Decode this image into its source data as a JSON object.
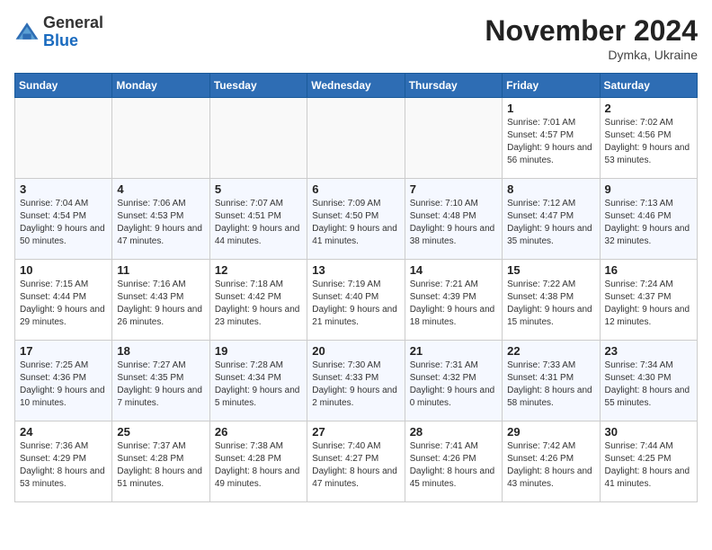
{
  "header": {
    "logo": {
      "line1": "General",
      "line2": "Blue"
    },
    "title": "November 2024",
    "subtitle": "Dymka, Ukraine"
  },
  "weekdays": [
    "Sunday",
    "Monday",
    "Tuesday",
    "Wednesday",
    "Thursday",
    "Friday",
    "Saturday"
  ],
  "weeks": [
    [
      {
        "day": "",
        "detail": ""
      },
      {
        "day": "",
        "detail": ""
      },
      {
        "day": "",
        "detail": ""
      },
      {
        "day": "",
        "detail": ""
      },
      {
        "day": "",
        "detail": ""
      },
      {
        "day": "1",
        "detail": "Sunrise: 7:01 AM\nSunset: 4:57 PM\nDaylight: 9 hours and 56 minutes."
      },
      {
        "day": "2",
        "detail": "Sunrise: 7:02 AM\nSunset: 4:56 PM\nDaylight: 9 hours and 53 minutes."
      }
    ],
    [
      {
        "day": "3",
        "detail": "Sunrise: 7:04 AM\nSunset: 4:54 PM\nDaylight: 9 hours and 50 minutes."
      },
      {
        "day": "4",
        "detail": "Sunrise: 7:06 AM\nSunset: 4:53 PM\nDaylight: 9 hours and 47 minutes."
      },
      {
        "day": "5",
        "detail": "Sunrise: 7:07 AM\nSunset: 4:51 PM\nDaylight: 9 hours and 44 minutes."
      },
      {
        "day": "6",
        "detail": "Sunrise: 7:09 AM\nSunset: 4:50 PM\nDaylight: 9 hours and 41 minutes."
      },
      {
        "day": "7",
        "detail": "Sunrise: 7:10 AM\nSunset: 4:48 PM\nDaylight: 9 hours and 38 minutes."
      },
      {
        "day": "8",
        "detail": "Sunrise: 7:12 AM\nSunset: 4:47 PM\nDaylight: 9 hours and 35 minutes."
      },
      {
        "day": "9",
        "detail": "Sunrise: 7:13 AM\nSunset: 4:46 PM\nDaylight: 9 hours and 32 minutes."
      }
    ],
    [
      {
        "day": "10",
        "detail": "Sunrise: 7:15 AM\nSunset: 4:44 PM\nDaylight: 9 hours and 29 minutes."
      },
      {
        "day": "11",
        "detail": "Sunrise: 7:16 AM\nSunset: 4:43 PM\nDaylight: 9 hours and 26 minutes."
      },
      {
        "day": "12",
        "detail": "Sunrise: 7:18 AM\nSunset: 4:42 PM\nDaylight: 9 hours and 23 minutes."
      },
      {
        "day": "13",
        "detail": "Sunrise: 7:19 AM\nSunset: 4:40 PM\nDaylight: 9 hours and 21 minutes."
      },
      {
        "day": "14",
        "detail": "Sunrise: 7:21 AM\nSunset: 4:39 PM\nDaylight: 9 hours and 18 minutes."
      },
      {
        "day": "15",
        "detail": "Sunrise: 7:22 AM\nSunset: 4:38 PM\nDaylight: 9 hours and 15 minutes."
      },
      {
        "day": "16",
        "detail": "Sunrise: 7:24 AM\nSunset: 4:37 PM\nDaylight: 9 hours and 12 minutes."
      }
    ],
    [
      {
        "day": "17",
        "detail": "Sunrise: 7:25 AM\nSunset: 4:36 PM\nDaylight: 9 hours and 10 minutes."
      },
      {
        "day": "18",
        "detail": "Sunrise: 7:27 AM\nSunset: 4:35 PM\nDaylight: 9 hours and 7 minutes."
      },
      {
        "day": "19",
        "detail": "Sunrise: 7:28 AM\nSunset: 4:34 PM\nDaylight: 9 hours and 5 minutes."
      },
      {
        "day": "20",
        "detail": "Sunrise: 7:30 AM\nSunset: 4:33 PM\nDaylight: 9 hours and 2 minutes."
      },
      {
        "day": "21",
        "detail": "Sunrise: 7:31 AM\nSunset: 4:32 PM\nDaylight: 9 hours and 0 minutes."
      },
      {
        "day": "22",
        "detail": "Sunrise: 7:33 AM\nSunset: 4:31 PM\nDaylight: 8 hours and 58 minutes."
      },
      {
        "day": "23",
        "detail": "Sunrise: 7:34 AM\nSunset: 4:30 PM\nDaylight: 8 hours and 55 minutes."
      }
    ],
    [
      {
        "day": "24",
        "detail": "Sunrise: 7:36 AM\nSunset: 4:29 PM\nDaylight: 8 hours and 53 minutes."
      },
      {
        "day": "25",
        "detail": "Sunrise: 7:37 AM\nSunset: 4:28 PM\nDaylight: 8 hours and 51 minutes."
      },
      {
        "day": "26",
        "detail": "Sunrise: 7:38 AM\nSunset: 4:28 PM\nDaylight: 8 hours and 49 minutes."
      },
      {
        "day": "27",
        "detail": "Sunrise: 7:40 AM\nSunset: 4:27 PM\nDaylight: 8 hours and 47 minutes."
      },
      {
        "day": "28",
        "detail": "Sunrise: 7:41 AM\nSunset: 4:26 PM\nDaylight: 8 hours and 45 minutes."
      },
      {
        "day": "29",
        "detail": "Sunrise: 7:42 AM\nSunset: 4:26 PM\nDaylight: 8 hours and 43 minutes."
      },
      {
        "day": "30",
        "detail": "Sunrise: 7:44 AM\nSunset: 4:25 PM\nDaylight: 8 hours and 41 minutes."
      }
    ]
  ]
}
